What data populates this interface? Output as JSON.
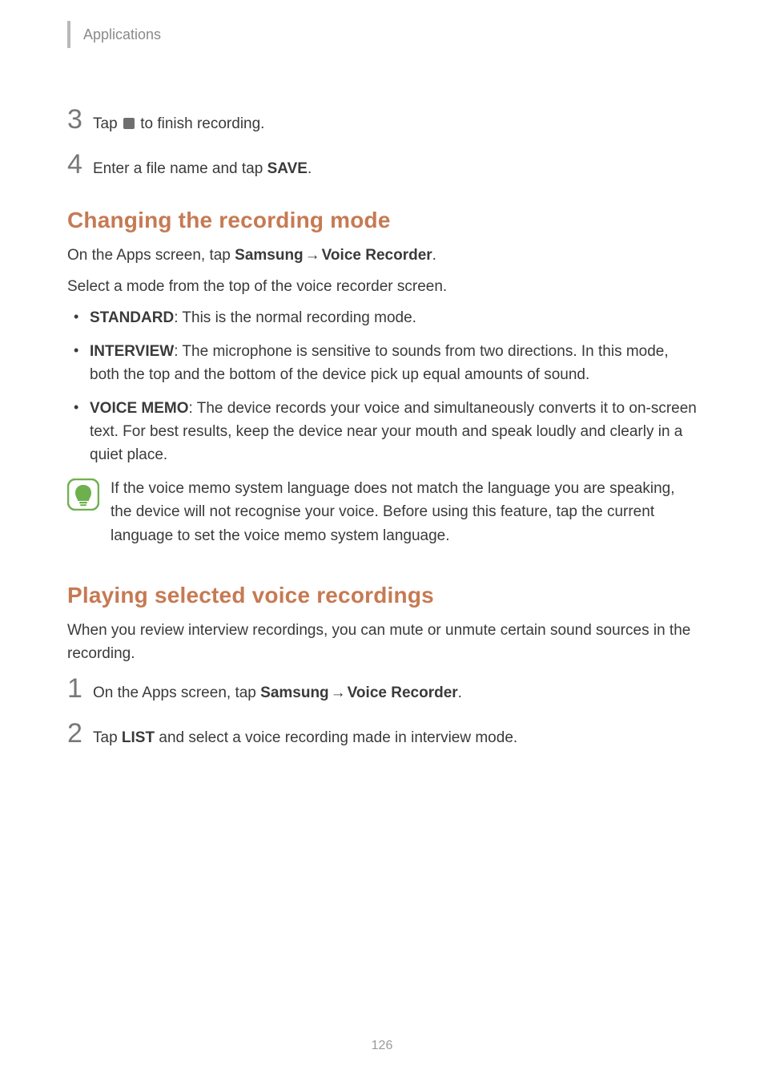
{
  "header": {
    "title": "Applications"
  },
  "steps_a": [
    {
      "num": "3",
      "pre": "Tap ",
      "post": " to finish recording.",
      "has_icon": true
    },
    {
      "num": "4",
      "pre": "Enter a file name and tap ",
      "bold": "SAVE",
      "post": "."
    }
  ],
  "section1": {
    "title": "Changing the recording mode",
    "line1_pre": "On the Apps screen, tap ",
    "line1_bold1": "Samsung",
    "line1_arrow": " → ",
    "line1_bold2": "Voice Recorder",
    "line1_post": ".",
    "line2": "Select a mode from the top of the voice recorder screen.",
    "bullets": [
      {
        "head": "STANDARD",
        "tail": ": This is the normal recording mode."
      },
      {
        "head": "INTERVIEW",
        "tail": ": The microphone is sensitive to sounds from two directions. In this mode, both the top and the bottom of the device pick up equal amounts of sound."
      },
      {
        "head": "VOICE MEMO",
        "tail": ": The device records your voice and simultaneously converts it to on-screen text. For best results, keep the device near your mouth and speak loudly and clearly in a quiet place."
      }
    ],
    "note": "If the voice memo system language does not match the language you are speaking, the device will not recognise your voice. Before using this feature, tap the current language to set the voice memo system language."
  },
  "section2": {
    "title": "Playing selected voice recordings",
    "intro": "When you review interview recordings, you can mute or unmute certain sound sources in the recording.",
    "steps": [
      {
        "num": "1",
        "pre": "On the Apps screen, tap ",
        "bold1": "Samsung",
        "arrow": " → ",
        "bold2": "Voice Recorder",
        "post": "."
      },
      {
        "num": "2",
        "pre": "Tap ",
        "bold1": "LIST",
        "post": " and select a voice recording made in interview mode."
      }
    ]
  },
  "page_number": "126"
}
